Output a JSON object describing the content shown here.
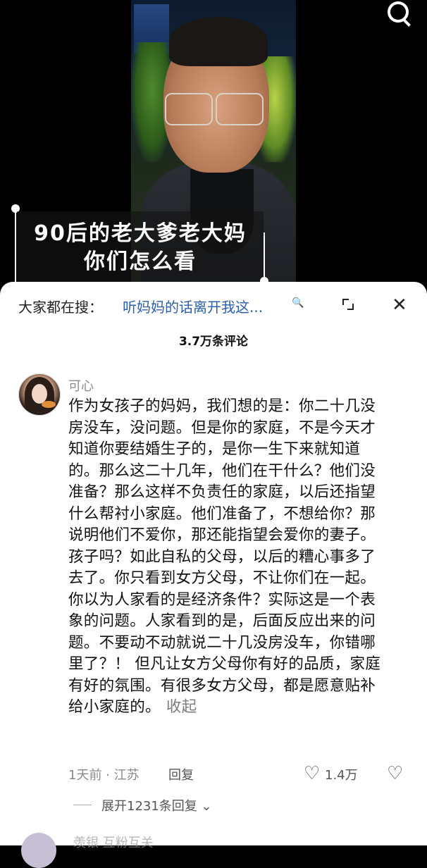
{
  "video": {
    "caption_line1": "90后的老大爹老大妈",
    "caption_line2": "你们怎么看",
    "search_icon": "search-icon"
  },
  "sheet": {
    "search_prefix": "大家都在搜：",
    "search_link": "听妈妈的话离开我这...",
    "search_link_icon": "🔍",
    "expand_icon": "expand-icon",
    "close_icon": "✕",
    "comment_count": "3.7万条评论"
  },
  "comment": {
    "username": "可心",
    "lines": [
      "作为女孩子的妈妈，我们想的是：你二十几没",
      "房没车，没问题。但是你的家庭，不是今天才",
      "知道你要结婚生子的，是你一生下来就知道",
      "的。那么这二十几年，他们在干什么？他们没",
      "准备？那么这样不负责任的家庭，以后还指望",
      "什么帮衬小家庭。他们准备了，不想给你？那",
      "说明他们不爱你，那还能指望会爱你的妻子。",
      "孩子吗？如此自私的父母，以后的糟心事多了",
      "去了。你只看到女方父母，不让你们在一起。",
      "你以为人家看的是经济条件？实际这是一个表",
      "象的问题。人家看到的是，后面反应出来的问",
      "题。不要动不动就说二十几没房没车，你错哪",
      "里了？！ 但凡让女方父母你有好的品质，家庭",
      "有好的氛围。有很多女方父母，都是愿意贴补",
      "给小家庭的。"
    ],
    "collapse_label": "收起",
    "time_location": "1天前 · 江苏",
    "reply_label": "回复",
    "like_icon": "♡",
    "like_count": "1.4万",
    "dislike_icon": "♡",
    "expand_replies": "展开1231条回复 ⌄"
  },
  "next_comment": {
    "username": "羡银 互粉互关"
  }
}
